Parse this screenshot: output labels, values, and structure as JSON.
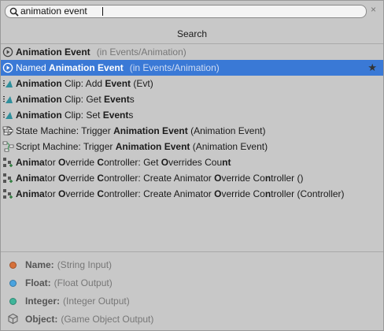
{
  "search": {
    "value": "animation event"
  },
  "clear_glyph": "×",
  "section_title": "Search",
  "star_glyph": "★",
  "results": [
    {
      "icon": "play-circle-icon",
      "segs": [
        {
          "t": "Animation Event",
          "b": true
        }
      ],
      "context": "(in Events/Animation)"
    },
    {
      "icon": "play-circle-icon",
      "segs": [
        {
          "t": "Named ",
          "b": false
        },
        {
          "t": "Animation Event",
          "b": true
        }
      ],
      "context": "(in Events/Animation)",
      "selected": true,
      "favorite": true
    },
    {
      "icon": "animation-clip-icon",
      "segs": [
        {
          "t": "Animation",
          "b": true
        },
        {
          "t": " Clip: Add ",
          "b": false
        },
        {
          "t": "Event",
          "b": true
        },
        {
          "t": " (Evt)",
          "b": false
        }
      ]
    },
    {
      "icon": "animation-clip-icon",
      "segs": [
        {
          "t": "Animation",
          "b": true
        },
        {
          "t": " Clip: Get ",
          "b": false
        },
        {
          "t": "Event",
          "b": true
        },
        {
          "t": "s",
          "b": false
        }
      ]
    },
    {
      "icon": "animation-clip-icon",
      "segs": [
        {
          "t": "Animation",
          "b": true
        },
        {
          "t": " Clip: Set ",
          "b": false
        },
        {
          "t": "Event",
          "b": true
        },
        {
          "t": "s",
          "b": false
        }
      ]
    },
    {
      "icon": "state-machine-icon",
      "segs": [
        {
          "t": "State Machine: Trigger ",
          "b": false
        },
        {
          "t": "Animation Event",
          "b": true
        },
        {
          "t": " (Animation Event)",
          "b": false
        }
      ]
    },
    {
      "icon": "script-machine-icon",
      "segs": [
        {
          "t": "Script Machine: Trigger ",
          "b": false
        },
        {
          "t": "Animation Event",
          "b": true
        },
        {
          "t": " (Animation Event)",
          "b": false
        }
      ]
    },
    {
      "icon": "animator-override-icon",
      "segs": [
        {
          "t": "Anima",
          "b": true
        },
        {
          "t": "tor ",
          "b": false
        },
        {
          "t": "O",
          "b": true
        },
        {
          "t": "verride ",
          "b": false
        },
        {
          "t": "C",
          "b": true
        },
        {
          "t": "ontroller: Get ",
          "b": false
        },
        {
          "t": "O",
          "b": true
        },
        {
          "t": "verrides Cou",
          "b": false
        },
        {
          "t": "nt",
          "b": true
        }
      ]
    },
    {
      "icon": "animator-override-icon",
      "segs": [
        {
          "t": "Anima",
          "b": true
        },
        {
          "t": "tor ",
          "b": false
        },
        {
          "t": "O",
          "b": true
        },
        {
          "t": "verride ",
          "b": false
        },
        {
          "t": "C",
          "b": true
        },
        {
          "t": "ontroller: Create Animator ",
          "b": false
        },
        {
          "t": "O",
          "b": true
        },
        {
          "t": "verride Co",
          "b": false
        },
        {
          "t": "n",
          "b": true
        },
        {
          "t": "troller ()",
          "b": false
        }
      ]
    },
    {
      "icon": "animator-override-icon",
      "segs": [
        {
          "t": "Anima",
          "b": true
        },
        {
          "t": "tor ",
          "b": false
        },
        {
          "t": "O",
          "b": true
        },
        {
          "t": "verride ",
          "b": false
        },
        {
          "t": "C",
          "b": true
        },
        {
          "t": "ontroller: Create Animator ",
          "b": false
        },
        {
          "t": "O",
          "b": true
        },
        {
          "t": "verride Co",
          "b": false
        },
        {
          "t": "n",
          "b": true
        },
        {
          "t": "troller (Controller)",
          "b": false
        }
      ]
    }
  ],
  "ports": [
    {
      "name": "Name:",
      "desc": "(String Input)",
      "color": "#d6703a",
      "icon": "circle"
    },
    {
      "name": "Float:",
      "desc": "(Float Output)",
      "color": "#4aa3df",
      "icon": "circle"
    },
    {
      "name": "Integer:",
      "desc": "(Integer Output)",
      "color": "#3fb59a",
      "icon": "circle"
    },
    {
      "name": "Object:",
      "desc": "(Game Object Output)",
      "color": "#666666",
      "icon": "cube"
    }
  ],
  "colors": {
    "selection": "#3a79d6",
    "background": "#c8c8c8"
  }
}
